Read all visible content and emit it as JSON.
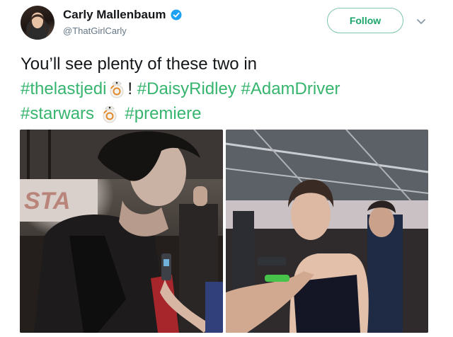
{
  "user": {
    "display_name": "Carly Mallenbaum",
    "handle": "@ThatGirlCarly"
  },
  "follow_label": "Follow",
  "tweet": {
    "line1": "You’ll see plenty of these two in",
    "hashtag_thelastjedi": "#thelastjedi",
    "exclamation": "!",
    "hashtag_daisyridley": "#DaisyRidley",
    "hashtag_adamdriver": "#AdamDriver",
    "hashtag_starwars": "#starwars",
    "hashtag_premiere": "#premiere"
  },
  "photo_backdrop_text": "STA",
  "icons": {
    "verified": "verified-badge-icon",
    "caret": "chevron-down-icon",
    "emoji": "bb8-emoji-icon"
  },
  "colors": {
    "hashtag": "#37b56e",
    "follow_border": "#7ec6a7",
    "follow_text": "#1da56b",
    "verified": "#1da1f2",
    "handle": "#657786"
  }
}
